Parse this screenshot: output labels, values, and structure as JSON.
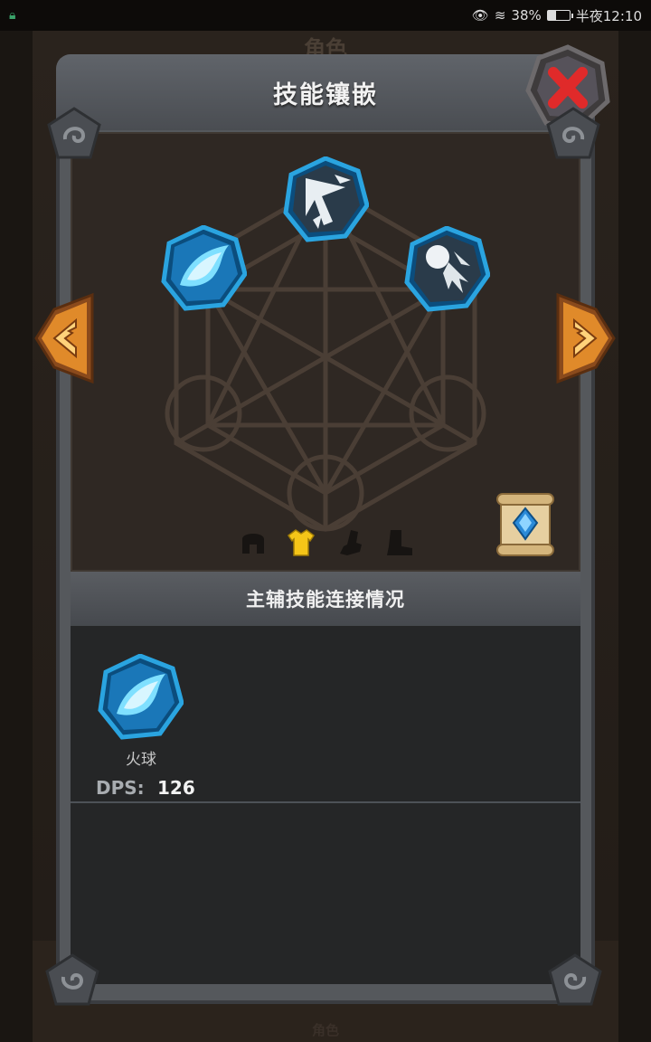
{
  "status_bar": {
    "battery": "38%",
    "time": "半夜12:10",
    "battery_level": 0.38
  },
  "background": {
    "title": "角色",
    "bottom_tab": "角色"
  },
  "panel": {
    "title": "技能镶嵌",
    "section_title": "主辅技能连接情况"
  },
  "skills_socketed": [
    {
      "icon": "fireball-icon",
      "slot": "left"
    },
    {
      "icon": "arrow-burst-icon",
      "slot": "top"
    },
    {
      "icon": "comet-icon",
      "slot": "right"
    }
  ],
  "equipment_tabs": [
    {
      "icon": "helmet-icon",
      "active": false
    },
    {
      "icon": "armor-icon",
      "active": true
    },
    {
      "icon": "gloves-icon",
      "active": false
    },
    {
      "icon": "boots-icon",
      "active": false
    }
  ],
  "connection": {
    "skill_name": "火球",
    "dps_label": "DPS:",
    "dps_value": "126"
  },
  "colors": {
    "socket_ring": "#1f8fd0",
    "active_tab": "#f5c518",
    "close_x": "#e02a2a",
    "arrow_orange": "#e08a2a"
  }
}
